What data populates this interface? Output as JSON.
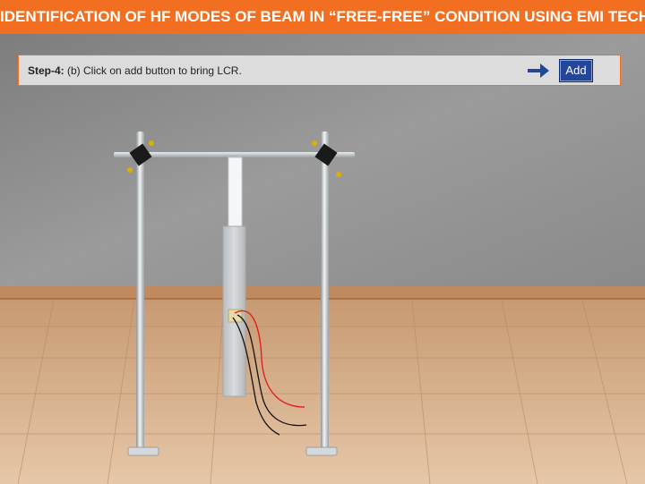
{
  "header": {
    "title": "IDENTIFICATION OF HF MODES OF BEAM IN “FREE-FREE” CONDITION USING EMI TECH."
  },
  "instruction": {
    "step_label": "Step-4:",
    "text": " (b) Click on add button to bring LCR."
  },
  "actions": {
    "add_label": "Add",
    "arrow_icon": "arrow-right-icon"
  },
  "colors": {
    "accent": "#f26f21",
    "button": "#22479a",
    "wire_red": "#e02020",
    "wire_black": "#111111"
  }
}
